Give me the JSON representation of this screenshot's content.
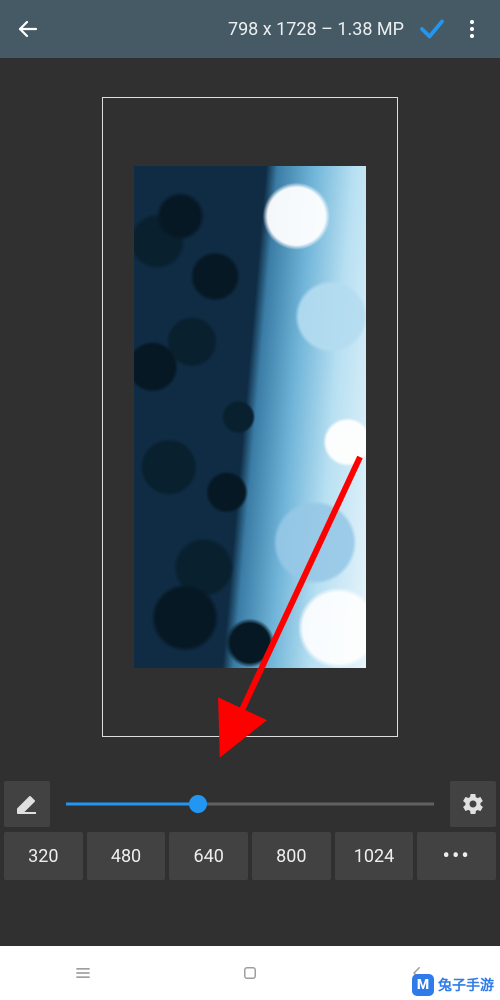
{
  "appbar": {
    "title": "798 x 1728 – 1.38 MP"
  },
  "slider": {
    "percent": 36
  },
  "presets": {
    "p0": "320",
    "p1": "480",
    "p2": "640",
    "p3": "800",
    "p4": "1024",
    "more": "•••"
  },
  "watermark": {
    "text": "兔子手游"
  },
  "colors": {
    "appbar_bg": "#455A64",
    "accent": "#2196F3",
    "surface": "#303030",
    "button": "#424242",
    "annotation": "#FF0000"
  }
}
